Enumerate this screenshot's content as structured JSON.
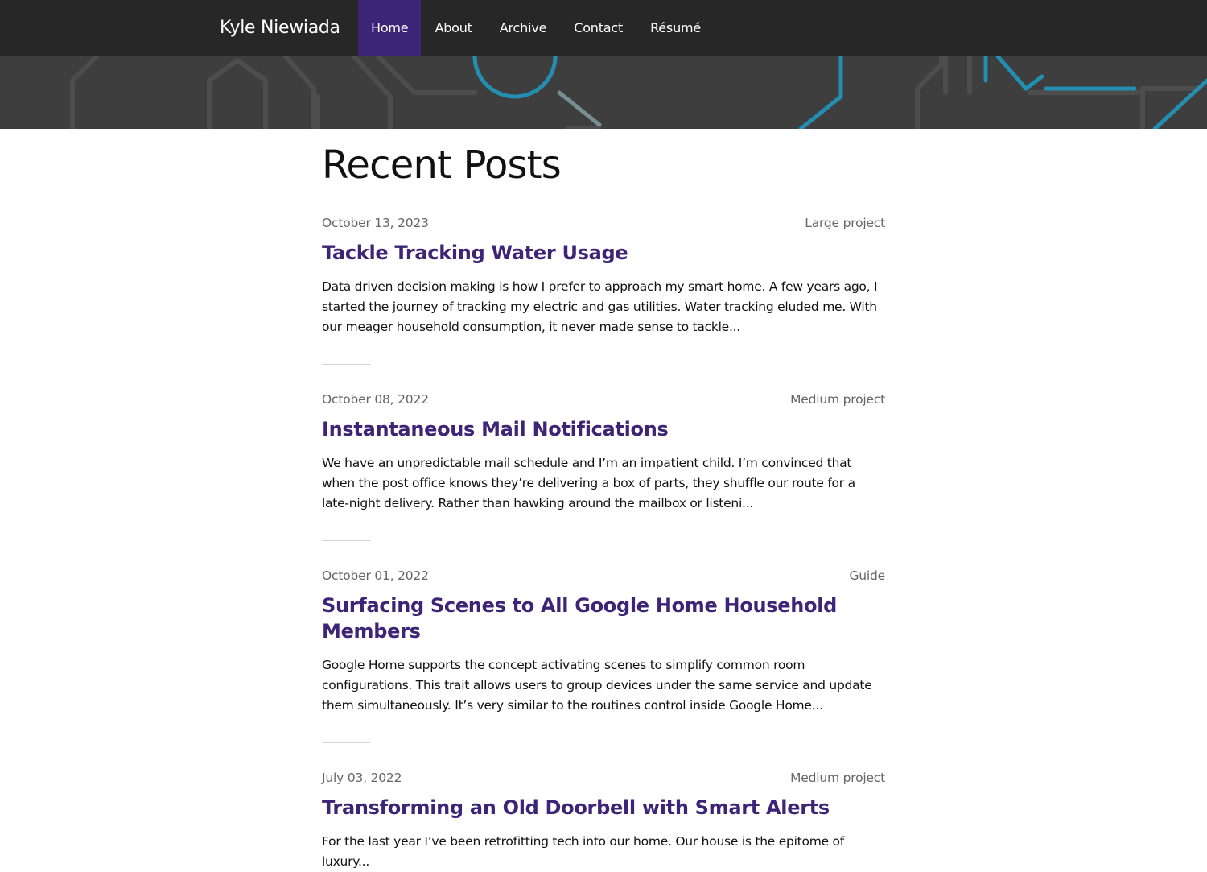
{
  "site": {
    "brand": "Kyle Niewiada"
  },
  "nav": {
    "items": [
      {
        "label": "Home",
        "active": true
      },
      {
        "label": "About"
      },
      {
        "label": "Archive"
      },
      {
        "label": "Contact"
      },
      {
        "label": "Résumé"
      }
    ]
  },
  "colors": {
    "navbar_bg": "#272727",
    "nav_active_bg": "#3d2476",
    "banner_bg": "#3e3e3e",
    "link": "#3d2476",
    "circuit_accent": "#1e9cc4"
  },
  "main": {
    "title": "Recent Posts",
    "posts": [
      {
        "date": "October 13, 2023",
        "type": "Large project",
        "title": "Tackle Tracking Water Usage",
        "excerpt": "Data driven decision making is how I prefer to approach my smart home. A few years ago, I started the journey of tracking my electric and gas utilities. Water tracking eluded me. With our meager household consumption, it never made sense to tackle..."
      },
      {
        "date": "October 08, 2022",
        "type": "Medium project",
        "title": "Instantaneous Mail Notifications",
        "excerpt": "We have an unpredictable mail schedule and I’m an impatient child. I’m convinced that when the post office knows they’re delivering a box of parts, they shuffle our route for a late-night delivery. Rather than hawking around the mailbox or listeni..."
      },
      {
        "date": "October 01, 2022",
        "type": "Guide",
        "title": "Surfacing Scenes to All Google Home Household Members",
        "excerpt": "Google Home supports the concept activating scenes to simplify common room configurations. This trait allows users to group devices under the same service and update them simultaneously. It’s very similar to the routines control inside Google Home..."
      },
      {
        "date": "July 03, 2022",
        "type": "Medium project",
        "title": "Transforming an Old Doorbell with Smart Alerts",
        "excerpt": "For the last year I’ve been retrofitting tech into our home. Our house is the epitome of luxury..."
      }
    ]
  }
}
